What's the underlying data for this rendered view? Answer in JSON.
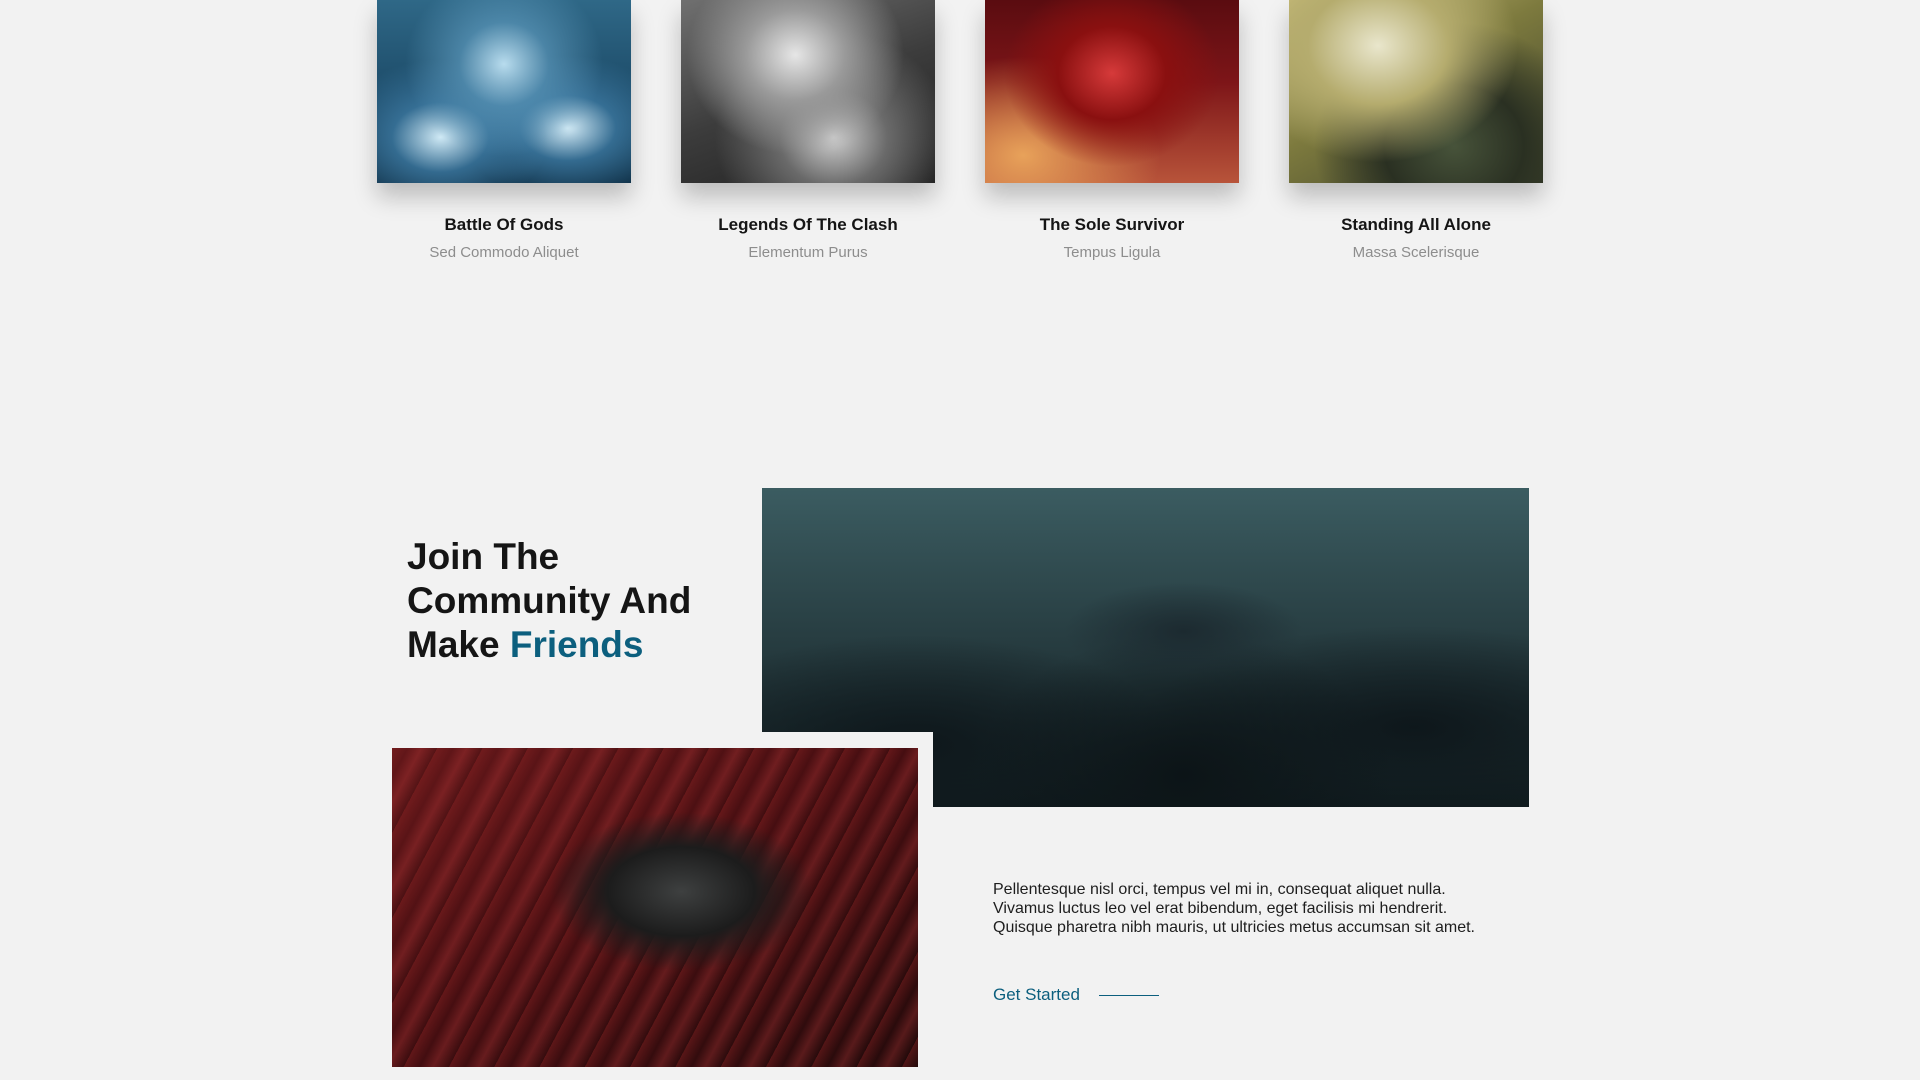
{
  "games": [
    {
      "title": "Battle Of Gods",
      "subtitle": "Sed Commodo Aliquet"
    },
    {
      "title": "Legends Of The Clash",
      "subtitle": "Elementum Purus"
    },
    {
      "title": "The Sole Survivor",
      "subtitle": "Tempus Ligula"
    },
    {
      "title": "Standing All Alone",
      "subtitle": "Massa Scelerisque"
    }
  ],
  "community": {
    "heading_line1": "Join The",
    "heading_line2": "Community And",
    "heading_line3_prefix": "Make ",
    "heading_accent": "Friends",
    "body": "Pellentesque nisl orci, tempus vel mi in, consequat aliquet nulla. Vivamus luctus leo vel erat bibendum, eget facilisis mi hendrerit. Quisque pharetra nibh mauris, ut ultricies metus accumsan sit amet.",
    "cta_label": "Get Started"
  },
  "colors": {
    "background": "#f2f2f2",
    "accent": "#0c5f7e",
    "title": "#151515",
    "subtitle": "#8d8d8d"
  }
}
